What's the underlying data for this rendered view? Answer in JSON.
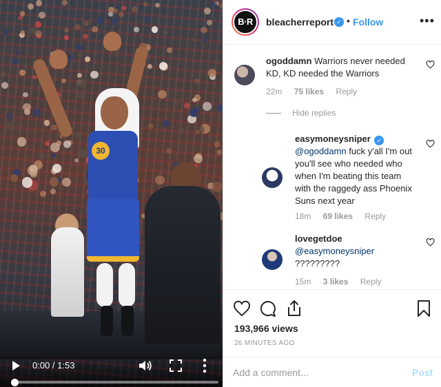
{
  "video": {
    "jersey_number": "30",
    "current_time": "0:00",
    "duration": "1:53",
    "time_separator": " / ",
    "progress": 0.0
  },
  "header": {
    "username": "bleacherreport",
    "avatar_text": "B·R",
    "verified_glyph": "✓",
    "dot": "•",
    "follow_label": "Follow",
    "more_glyph": "•••"
  },
  "comments": [
    {
      "username": "ogoddamn",
      "text": "Warriors never needed KD, KD needed the Warriors",
      "time": "22m",
      "likes": "75 likes",
      "reply_label": "Reply"
    }
  ],
  "hide_replies_label": "Hide replies",
  "replies": [
    {
      "username": "easymoneysniper",
      "verified": true,
      "mention": "@ogoddamn",
      "text": " fuck y'all I'm out you'll see who needed who when I'm beating this team with the raggedy ass Phoenix Suns next year",
      "time": "18m",
      "likes": "69 likes",
      "reply_label": "Reply"
    },
    {
      "username": "lovegetdoe",
      "verified": false,
      "mention": "@easymoneysniper",
      "text": "?????????",
      "time": "15m",
      "likes": "3 likes",
      "reply_label": "Reply"
    }
  ],
  "stats": {
    "views": "193,966 views",
    "posted": "26 MINUTES AGO"
  },
  "add_comment": {
    "placeholder": "Add a comment...",
    "post_label": "Post"
  },
  "colors": {
    "link_blue": "#3897f0",
    "mention_blue": "#003569",
    "muted_gray": "#999999",
    "post_disabled": "#b2dffc"
  }
}
